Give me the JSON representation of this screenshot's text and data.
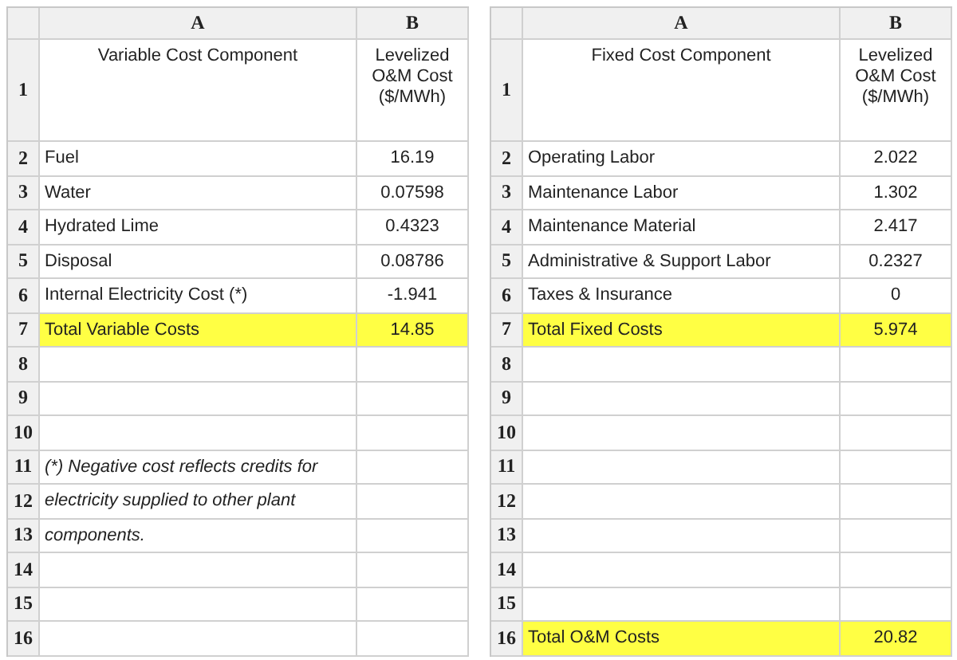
{
  "sheets": [
    {
      "columns": [
        "A",
        "B"
      ],
      "rows": [
        {
          "number": "1",
          "kind": "header",
          "highlighted": false,
          "cells": [
            "Variable Cost Component",
            "Levelized O&M Cost ($/MWh)"
          ]
        },
        {
          "number": "2",
          "kind": "data",
          "highlighted": false,
          "cells": [
            "Fuel",
            "16.19"
          ]
        },
        {
          "number": "3",
          "kind": "data",
          "highlighted": false,
          "cells": [
            "Water",
            "0.07598"
          ]
        },
        {
          "number": "4",
          "kind": "data",
          "highlighted": false,
          "cells": [
            "Hydrated Lime",
            "0.4323"
          ]
        },
        {
          "number": "5",
          "kind": "data",
          "highlighted": false,
          "cells": [
            "Disposal",
            "0.08786"
          ]
        },
        {
          "number": "6",
          "kind": "data",
          "highlighted": false,
          "cells": [
            "Internal Electricity Cost (*)",
            "-1.941"
          ]
        },
        {
          "number": "7",
          "kind": "data",
          "highlighted": true,
          "cells": [
            "Total Variable Costs",
            "14.85"
          ]
        },
        {
          "number": "8",
          "kind": "data",
          "highlighted": false
        },
        {
          "number": "9",
          "kind": "data",
          "highlighted": false
        },
        {
          "number": "10",
          "kind": "data",
          "highlighted": false
        },
        {
          "number": "11",
          "kind": "note",
          "highlighted": false,
          "cells": [
            "(*) Negative cost reflects credits for"
          ]
        },
        {
          "number": "12",
          "kind": "note",
          "highlighted": false,
          "cells": [
            "electricity supplied to other plant"
          ]
        },
        {
          "number": "13",
          "kind": "note",
          "highlighted": false,
          "cells": [
            "components."
          ]
        },
        {
          "number": "14",
          "kind": "data",
          "highlighted": false
        },
        {
          "number": "15",
          "kind": "data",
          "highlighted": false
        },
        {
          "number": "16",
          "kind": "data",
          "highlighted": false
        }
      ]
    },
    {
      "columns": [
        "A",
        "B"
      ],
      "rows": [
        {
          "number": "1",
          "kind": "header",
          "highlighted": false,
          "cells": [
            "Fixed Cost Component",
            "Levelized O&M Cost ($/MWh)"
          ]
        },
        {
          "number": "2",
          "kind": "data",
          "highlighted": false,
          "cells": [
            "Operating Labor",
            "2.022"
          ]
        },
        {
          "number": "3",
          "kind": "data",
          "highlighted": false,
          "cells": [
            "Maintenance Labor",
            "1.302"
          ]
        },
        {
          "number": "4",
          "kind": "data",
          "highlighted": false,
          "cells": [
            "Maintenance Material",
            "2.417"
          ]
        },
        {
          "number": "5",
          "kind": "data",
          "highlighted": false,
          "cells": [
            "Administrative & Support Labor",
            "0.2327"
          ]
        },
        {
          "number": "6",
          "kind": "data",
          "highlighted": false,
          "cells": [
            "Taxes & Insurance",
            "0"
          ]
        },
        {
          "number": "7",
          "kind": "data",
          "highlighted": true,
          "cells": [
            "Total Fixed Costs",
            "5.974"
          ]
        },
        {
          "number": "8",
          "kind": "data",
          "highlighted": false
        },
        {
          "number": "9",
          "kind": "data",
          "highlighted": false
        },
        {
          "number": "10",
          "kind": "data",
          "highlighted": false
        },
        {
          "number": "11",
          "kind": "data",
          "highlighted": false
        },
        {
          "number": "12",
          "kind": "data",
          "highlighted": false
        },
        {
          "number": "13",
          "kind": "data",
          "highlighted": false
        },
        {
          "number": "14",
          "kind": "data",
          "highlighted": false
        },
        {
          "number": "15",
          "kind": "data",
          "highlighted": false
        },
        {
          "number": "16",
          "kind": "data",
          "highlighted": true,
          "cells": [
            "Total O&M Costs",
            "20.82"
          ]
        }
      ]
    }
  ]
}
